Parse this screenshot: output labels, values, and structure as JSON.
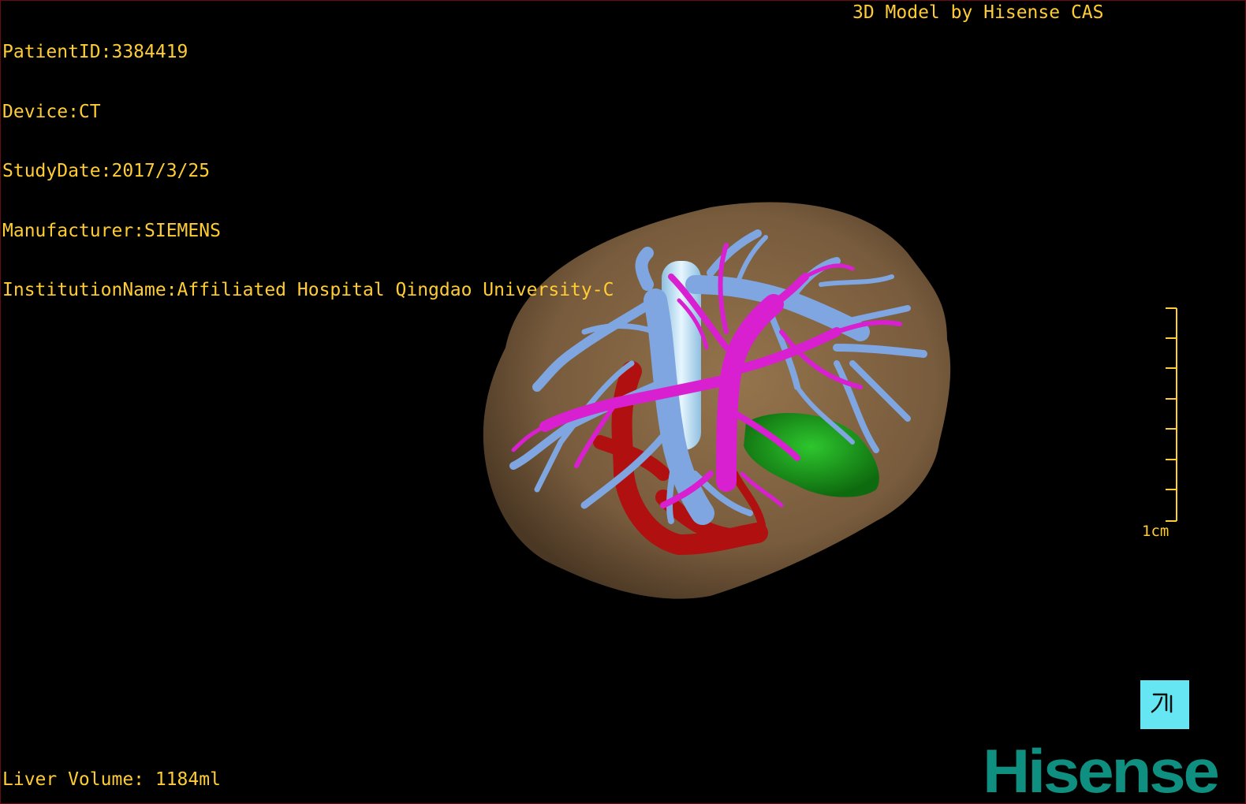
{
  "overlay": {
    "patient_id": "PatientID:3384419",
    "device": "Device:CT",
    "study_date": "StudyDate:2017/3/25",
    "manufacturer": "Manufacturer:SIEMENS",
    "institution": "InstitutionName:Affiliated Hospital Qingdao University-C",
    "model_credit": "3D Model by Hisense CAS",
    "liver_volume": "Liver Volume: 1184ml"
  },
  "scale_bar": {
    "label": "1cm"
  },
  "logo": {
    "text": "Hisense",
    "color": "#0f8f80"
  },
  "icons": {
    "camera_reset": "camera-reset-icon"
  },
  "colors": {
    "overlay_text": "#ffcc33",
    "liver": "#8a6a45",
    "hepatic_vein": "#7fa6e0",
    "portal_vein": "#d820d0",
    "artery": "#b01010",
    "tumor": "#1a9a1a",
    "ivc": "#bfe2f5",
    "button_bg": "#66e6f2"
  }
}
